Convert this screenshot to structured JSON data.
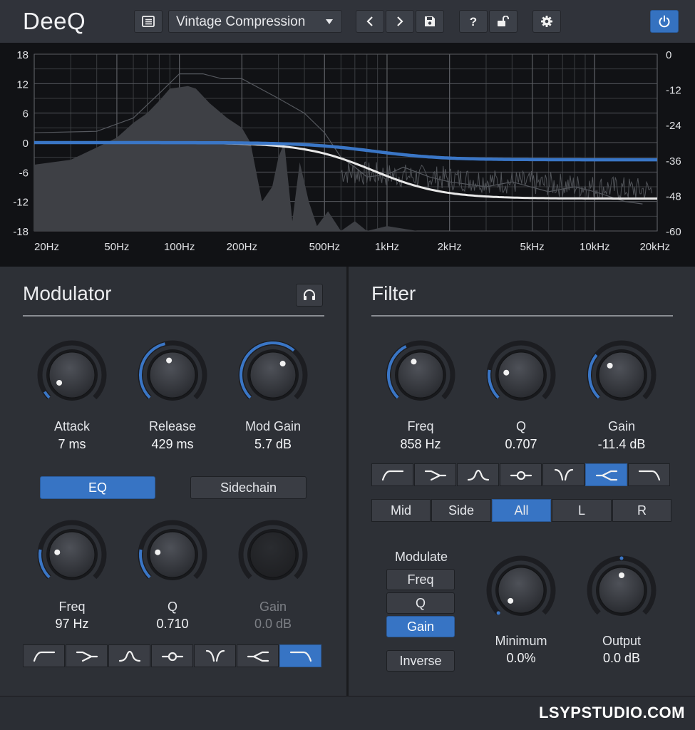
{
  "app": {
    "title": "DeeQ"
  },
  "toolbar": {
    "preset": "Vintage Compression"
  },
  "graph": {
    "y_left_labels": [
      "18",
      "12",
      "6",
      "0",
      "-6",
      "-12",
      "-18"
    ],
    "y_right_labels": [
      "0",
      "-12",
      "-24",
      "-36",
      "-48",
      "-60"
    ],
    "x_labels": [
      "20Hz",
      "50Hz",
      "100Hz",
      "200Hz",
      "500Hz",
      "1kHz",
      "2kHz",
      "5kHz",
      "10kHz",
      "20kHz"
    ]
  },
  "modulator": {
    "title": "Modulator",
    "knobs": [
      {
        "label": "Attack",
        "value": "7 ms",
        "level": 0.05
      },
      {
        "label": "Release",
        "value": "429 ms",
        "level": 0.45
      },
      {
        "label": "Mod Gain",
        "value": "5.7 dB",
        "level": 0.65
      }
    ],
    "mode_buttons": [
      "EQ",
      "Sidechain"
    ],
    "eq_knobs": [
      {
        "label": "Freq",
        "value": "97 Hz",
        "level": 0.2
      },
      {
        "label": "Q",
        "value": "0.710",
        "level": 0.2
      },
      {
        "label": "Gain",
        "value": "0.0 dB",
        "level": 0.0
      }
    ]
  },
  "filter": {
    "title": "Filter",
    "knobs": [
      {
        "label": "Freq",
        "value": "858 Hz",
        "level": 0.4
      },
      {
        "label": "Q",
        "value": "0.707",
        "level": 0.2
      },
      {
        "label": "Gain",
        "value": "-11.4 dB",
        "level": 0.31
      }
    ],
    "channels": [
      "Mid",
      "Side",
      "All",
      "L",
      "R"
    ],
    "modulate_label": "Modulate",
    "modulate_options": [
      "Freq",
      "Q",
      "Gain"
    ],
    "inverse_label": "Inverse",
    "extra_knobs": [
      {
        "label": "Minimum",
        "value": "0.0%",
        "level": 0.0
      },
      {
        "label": "Output",
        "value": "0.0 dB",
        "level": 0.5
      }
    ]
  },
  "footer": {
    "brand": "LSYPSTUDIO.COM"
  },
  "colors": {
    "accent": "#3774c4",
    "curve_white": "#e8e8e8",
    "background": "#2d3036"
  }
}
